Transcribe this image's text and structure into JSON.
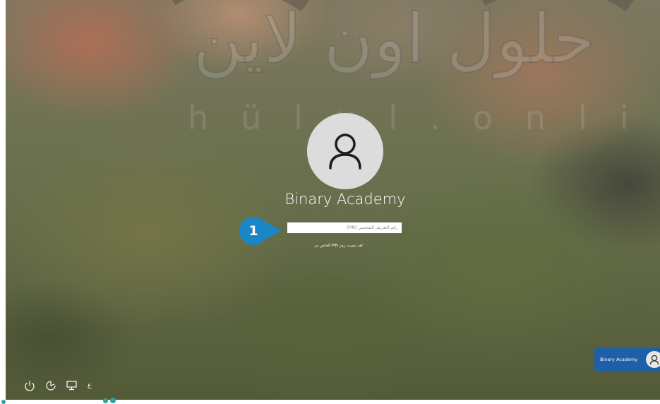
{
  "watermark": {
    "logo_text": "حلول اون لاين",
    "url_text": "hülul.onlin"
  },
  "login": {
    "username": "Binary Academy",
    "pin_placeholder": "رقم التعريف الشخصي (PIN)",
    "forgot_pin": "لقد نسيت رمز PIN الخاص بي"
  },
  "callout": {
    "number": "1",
    "color": "#1a86c8"
  },
  "footer": {
    "icons": [
      "power-icon",
      "ease-of-access-icon",
      "network-icon"
    ],
    "language": "ع"
  },
  "user_tile": {
    "name": "Binary Academy",
    "color": "#1d5fa8"
  }
}
